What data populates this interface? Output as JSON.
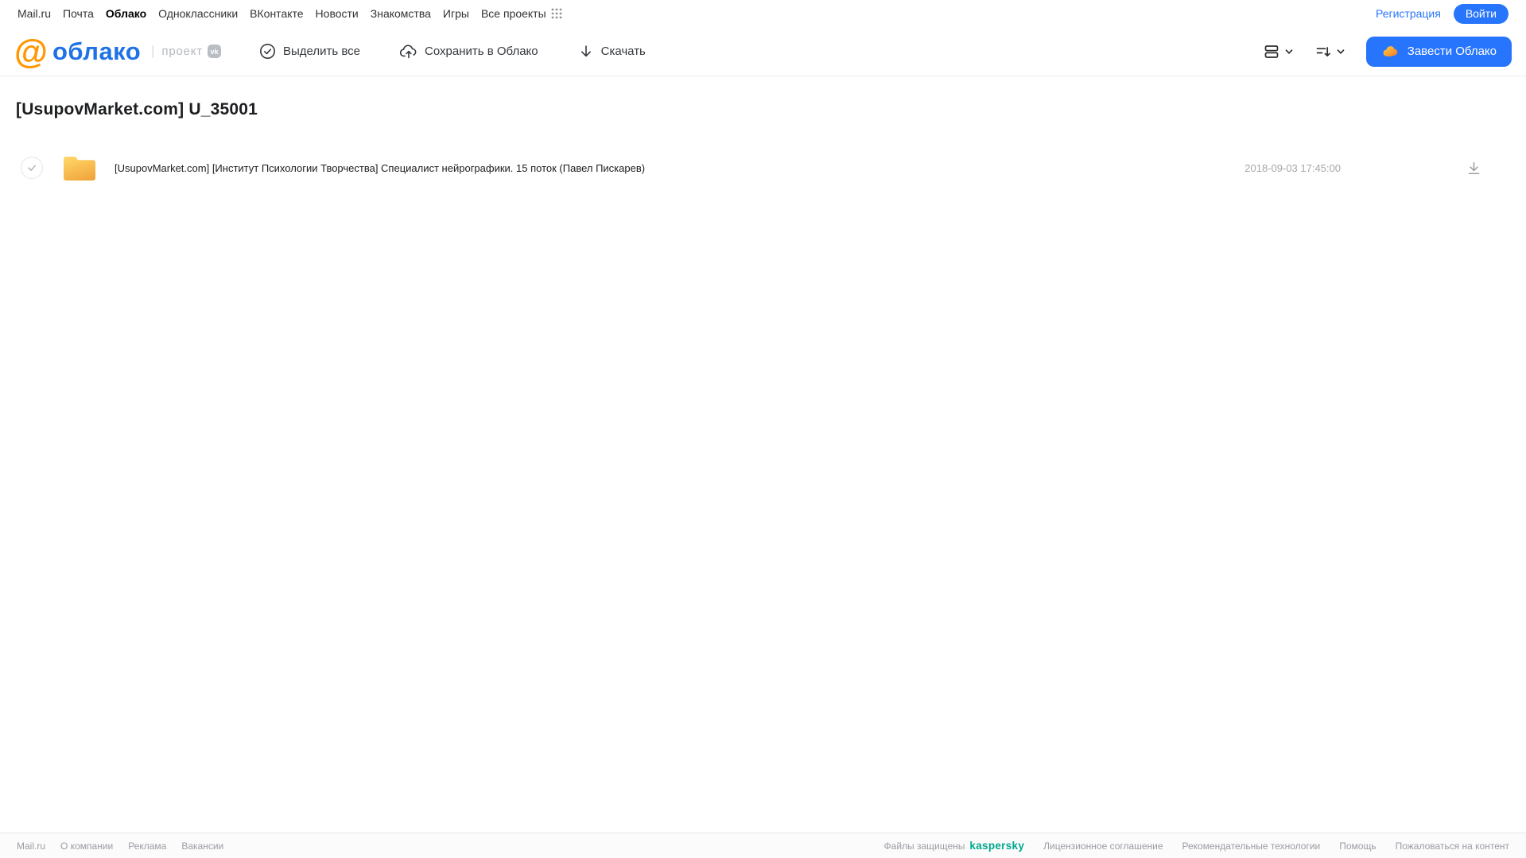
{
  "colors": {
    "accent_blue": "#2775fc",
    "brand_blue": "#2072e4",
    "brand_orange": "#ff9800",
    "kaspersky_green": "#00a88e",
    "folder_yellow_top": "#ffd466",
    "folder_yellow_bottom": "#f0a63c"
  },
  "topnav": {
    "links": [
      {
        "label": "Mail.ru"
      },
      {
        "label": "Почта"
      },
      {
        "label": "Облако"
      },
      {
        "label": "Одноклассники"
      },
      {
        "label": "ВКонтакте"
      },
      {
        "label": "Новости"
      },
      {
        "label": "Знакомства"
      },
      {
        "label": "Игры"
      },
      {
        "label": "Все проекты"
      }
    ],
    "registration_label": "Регистрация",
    "login_label": "Войти"
  },
  "header": {
    "brand": "облако",
    "project_label": "проект",
    "vk_badge": "vk",
    "toolbar": {
      "select_all_label": "Выделить все",
      "save_to_cloud_label": "Сохранить в Облако",
      "download_label": "Скачать"
    },
    "cta_label": "Завести Облако"
  },
  "page": {
    "title": "[UsupovMarket.com] U_35001"
  },
  "files": [
    {
      "type": "folder",
      "name": "[UsupovMarket.com] [Институт Психологии Творчества] Специалист нейрографики. 15 поток (Павел Пискарев)",
      "modified": "2018-09-03 17:45:00"
    }
  ],
  "footer": {
    "left_links": [
      {
        "label": "Mail.ru"
      },
      {
        "label": "О компании"
      },
      {
        "label": "Реклама"
      },
      {
        "label": "Вакансии"
      }
    ],
    "protected_label": "Файлы защищены",
    "kaspersky_label": "kaspersky",
    "right_links": [
      {
        "label": "Лицензионное соглашение"
      },
      {
        "label": "Рекомендательные технологии"
      },
      {
        "label": "Помощь"
      },
      {
        "label": "Пожаловаться на контент"
      }
    ]
  }
}
